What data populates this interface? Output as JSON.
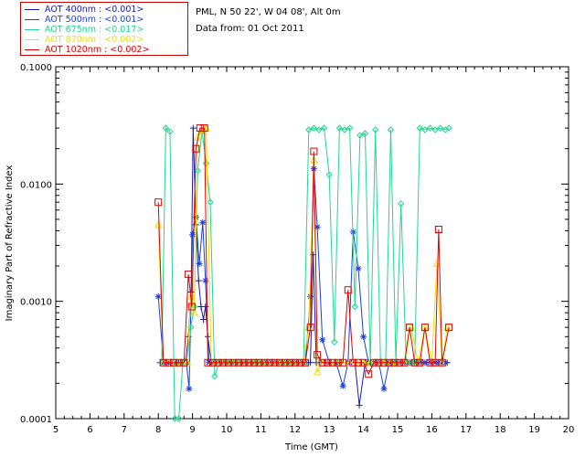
{
  "info": {
    "site": "PML, N 50 22', W 04 08', Alt 0m",
    "date": "Data from: 01 Oct 2011"
  },
  "chart_data": {
    "type": "line",
    "title": "",
    "xlabel": "Time (GMT)",
    "ylabel": "Imaginary Part of Refractive Index",
    "xlim": [
      5,
      20
    ],
    "ylim": [
      0.0001,
      0.1
    ],
    "yscale": "log",
    "x_ticks": [
      "5",
      "6",
      "7",
      "8",
      "9",
      "10",
      "11",
      "12",
      "13",
      "14",
      "15",
      "16",
      "17",
      "18",
      "19",
      "20"
    ],
    "y_ticks": [
      "0.0001",
      "0.0010",
      "0.0100",
      "0.1000"
    ],
    "legend_position": "top-left",
    "series": [
      {
        "name": "AOT  400nm : <0.001>",
        "color": "#1a1aa6",
        "marker": "plus",
        "x": [
          8.05,
          8.2,
          8.3,
          8.4,
          8.5,
          8.6,
          8.7,
          8.8,
          8.88,
          8.96,
          9.02,
          9.1,
          9.18,
          9.25,
          9.32,
          9.38,
          9.45,
          9.55,
          9.65,
          9.75,
          9.85,
          9.95,
          10.05,
          10.15,
          10.25,
          10.35,
          10.45,
          10.55,
          10.65,
          10.75,
          10.85,
          10.95,
          11.05,
          11.15,
          11.25,
          11.35,
          11.45,
          11.55,
          11.65,
          11.75,
          11.85,
          11.95,
          12.05,
          12.15,
          12.3,
          12.45,
          12.53,
          12.62,
          12.75,
          12.88,
          13.05,
          13.2,
          13.35,
          13.5,
          13.65,
          13.75,
          13.88,
          14.05,
          14.2,
          14.35,
          14.5,
          14.65,
          14.8,
          14.95,
          15.1,
          15.25,
          15.4,
          15.55,
          15.7,
          15.85,
          16.0,
          16.15,
          16.3,
          16.45
        ],
        "y": [
          0.0003,
          0.0003,
          0.0003,
          0.0003,
          0.0003,
          0.0003,
          0.0003,
          0.0003,
          0.0005,
          0.0012,
          0.03,
          0.0045,
          0.0015,
          0.0009,
          0.0007,
          0.0009,
          0.0005,
          0.0003,
          0.0003,
          0.0003,
          0.0003,
          0.0003,
          0.0003,
          0.0003,
          0.0003,
          0.0003,
          0.0003,
          0.0003,
          0.0003,
          0.0003,
          0.0003,
          0.0003,
          0.0003,
          0.0003,
          0.0003,
          0.0003,
          0.0003,
          0.0003,
          0.0003,
          0.0003,
          0.0003,
          0.0003,
          0.0003,
          0.0003,
          0.0003,
          0.0003,
          0.0025,
          0.0003,
          0.0003,
          0.0003,
          0.0003,
          0.0003,
          0.0003,
          0.0003,
          0.0003,
          0.0003,
          0.00013,
          0.0003,
          0.0003,
          0.0003,
          0.0003,
          0.0003,
          0.0003,
          0.0003,
          0.0003,
          0.0003,
          0.0003,
          0.0003,
          0.0003,
          0.0003,
          0.0003,
          0.0003,
          0.0003,
          0.0003
        ]
      },
      {
        "name": "AOT  500nm : <0.001>",
        "color": "#1a3fe0",
        "marker": "star",
        "x": [
          8.0,
          8.15,
          8.3,
          8.5,
          8.7,
          8.82,
          8.9,
          9.0,
          9.1,
          9.2,
          9.3,
          9.38,
          9.48,
          9.6,
          9.75,
          9.9,
          10.05,
          10.2,
          10.35,
          10.5,
          10.65,
          10.8,
          10.95,
          11.1,
          11.25,
          11.4,
          11.55,
          11.7,
          11.85,
          12.0,
          12.15,
          12.3,
          12.45,
          12.55,
          12.65,
          12.8,
          13.0,
          13.2,
          13.4,
          13.55,
          13.7,
          13.85,
          14.0,
          14.15,
          14.3,
          14.45,
          14.6,
          14.75,
          14.9,
          15.05,
          15.2,
          15.35,
          15.5,
          15.65,
          15.8,
          15.95,
          16.1,
          16.25,
          16.4
        ],
        "y": [
          0.0011,
          0.0003,
          0.0003,
          0.0003,
          0.0003,
          0.0003,
          0.00018,
          0.0037,
          0.0052,
          0.0021,
          0.0047,
          0.0015,
          0.0003,
          0.0003,
          0.0003,
          0.0003,
          0.0003,
          0.0003,
          0.0003,
          0.0003,
          0.0003,
          0.0003,
          0.0003,
          0.0003,
          0.0003,
          0.0003,
          0.0003,
          0.0003,
          0.0003,
          0.0003,
          0.0003,
          0.0003,
          0.0011,
          0.0135,
          0.0043,
          0.00047,
          0.0003,
          0.0003,
          0.00019,
          0.0003,
          0.0039,
          0.0019,
          0.0005,
          0.0003,
          0.0003,
          0.0003,
          0.00018,
          0.0003,
          0.0003,
          0.0003,
          0.0003,
          0.0003,
          0.0003,
          0.0003,
          0.0003,
          0.0003,
          0.0003,
          0.0003,
          0.0003
        ]
      },
      {
        "name": "AOT  675nm : <0.017>",
        "color": "#20d890",
        "marker": "diamond",
        "x": [
          8.1,
          8.22,
          8.34,
          8.48,
          8.6,
          8.72,
          8.85,
          8.95,
          9.05,
          9.15,
          9.28,
          9.4,
          9.52,
          9.65,
          9.78,
          9.9,
          10.05,
          10.18,
          10.32,
          10.48,
          10.62,
          10.78,
          10.92,
          11.05,
          11.2,
          11.35,
          11.5,
          11.65,
          11.8,
          11.95,
          12.1,
          12.25,
          12.4,
          12.55,
          12.7,
          12.85,
          13.0,
          13.15,
          13.3,
          13.45,
          13.6,
          13.75,
          13.9,
          14.05,
          14.2,
          14.35,
          14.5,
          14.65,
          14.8,
          14.95,
          15.1,
          15.25,
          15.4,
          15.5,
          15.65,
          15.8,
          15.95,
          16.1,
          16.25,
          16.4,
          16.5
        ],
        "y": [
          0.0003,
          0.03,
          0.028,
          0.0001,
          0.0001,
          0.0003,
          0.0003,
          0.0006,
          0.0009,
          0.013,
          0.028,
          0.015,
          0.007,
          0.00023,
          0.0003,
          0.0003,
          0.0003,
          0.0003,
          0.0003,
          0.0003,
          0.0003,
          0.0003,
          0.0003,
          0.0003,
          0.0003,
          0.0003,
          0.0003,
          0.0003,
          0.0003,
          0.0003,
          0.0003,
          0.0003,
          0.029,
          0.03,
          0.029,
          0.03,
          0.012,
          0.00045,
          0.03,
          0.029,
          0.03,
          0.0009,
          0.026,
          0.027,
          0.0003,
          0.029,
          0.0003,
          0.0003,
          0.029,
          0.0003,
          0.0068,
          0.0003,
          0.0003,
          0.0003,
          0.03,
          0.029,
          0.03,
          0.029,
          0.03,
          0.029,
          0.03
        ]
      },
      {
        "name": "AOT  870nm : <0.002>",
        "color": "#f0e000",
        "marker": "triangle",
        "x": [
          8.0,
          8.15,
          8.3,
          8.5,
          8.7,
          8.85,
          8.95,
          9.05,
          9.15,
          9.28,
          9.4,
          9.55,
          9.7,
          9.85,
          10.0,
          10.15,
          10.3,
          10.45,
          10.6,
          10.75,
          10.9,
          11.05,
          11.2,
          11.35,
          11.5,
          11.65,
          11.8,
          11.95,
          12.1,
          12.25,
          12.4,
          12.55,
          12.65,
          12.8,
          13.0,
          13.2,
          13.4,
          13.6,
          13.8,
          14.0,
          14.2,
          14.4,
          14.6,
          14.8,
          15.0,
          15.2,
          15.4,
          15.6,
          15.8,
          16.0,
          16.15,
          16.3,
          16.45
        ],
        "y": [
          0.0045,
          0.0003,
          0.0003,
          0.0003,
          0.0003,
          0.0003,
          0.0011,
          0.0008,
          0.025,
          0.028,
          0.03,
          0.0003,
          0.0003,
          0.0003,
          0.0003,
          0.0003,
          0.0003,
          0.0003,
          0.0003,
          0.0003,
          0.0003,
          0.0003,
          0.0003,
          0.0003,
          0.0003,
          0.0003,
          0.0003,
          0.0003,
          0.0003,
          0.0003,
          0.0006,
          0.016,
          0.00025,
          0.0003,
          0.0003,
          0.0003,
          0.0003,
          0.0003,
          0.0003,
          0.0003,
          0.0003,
          0.0003,
          0.0003,
          0.0003,
          0.0003,
          0.0003,
          0.0006,
          0.0003,
          0.0006,
          0.0003,
          0.0021,
          0.0003,
          0.0006
        ]
      },
      {
        "name": "AOT 1020nm : <0.002>",
        "color": "#e00000",
        "marker": "square",
        "x": [
          8.0,
          8.15,
          8.3,
          8.45,
          8.6,
          8.75,
          8.88,
          8.98,
          9.1,
          9.22,
          9.35,
          9.45,
          9.6,
          9.75,
          9.9,
          10.05,
          10.2,
          10.35,
          10.5,
          10.65,
          10.8,
          10.95,
          11.1,
          11.25,
          11.4,
          11.55,
          11.7,
          11.85,
          12.0,
          12.15,
          12.3,
          12.45,
          12.55,
          12.65,
          12.8,
          12.95,
          13.1,
          13.25,
          13.4,
          13.55,
          13.7,
          13.85,
          14.0,
          14.15,
          14.3,
          14.45,
          14.6,
          14.75,
          14.9,
          15.05,
          15.2,
          15.35,
          15.5,
          15.65,
          15.8,
          15.95,
          16.1,
          16.2,
          16.3,
          16.5
        ],
        "y": [
          0.007,
          0.0003,
          0.0003,
          0.0003,
          0.0003,
          0.0003,
          0.0017,
          0.0009,
          0.02,
          0.03,
          0.03,
          0.0003,
          0.0003,
          0.0003,
          0.0003,
          0.0003,
          0.0003,
          0.0003,
          0.0003,
          0.0003,
          0.0003,
          0.0003,
          0.0003,
          0.0003,
          0.0003,
          0.0003,
          0.0003,
          0.0003,
          0.0003,
          0.0003,
          0.0003,
          0.0006,
          0.019,
          0.00035,
          0.0003,
          0.0003,
          0.0003,
          0.0003,
          0.0003,
          0.00125,
          0.0003,
          0.0003,
          0.0003,
          0.00024,
          0.0003,
          0.0003,
          0.0003,
          0.0003,
          0.0003,
          0.0003,
          0.0003,
          0.0006,
          0.0003,
          0.0003,
          0.0006,
          0.0003,
          0.0003,
          0.0041,
          0.0003,
          0.0006
        ]
      }
    ]
  }
}
